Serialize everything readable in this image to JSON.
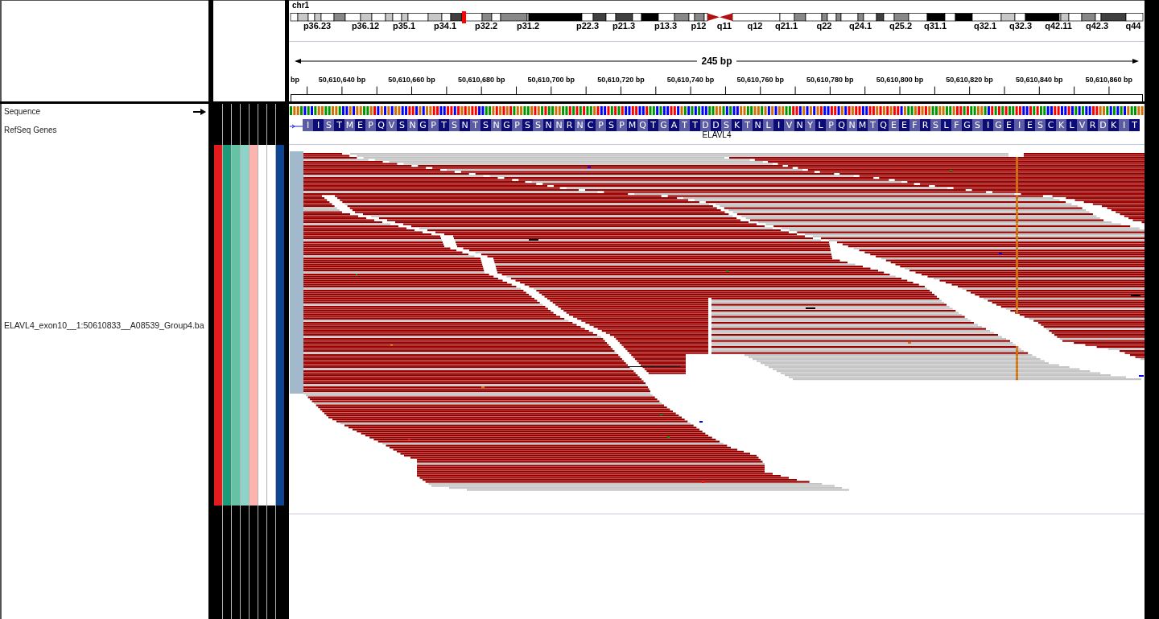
{
  "header": {
    "chromosome": "chr1",
    "cytobands": [
      "p36.23",
      "p36.12",
      "p35.1",
      "p34.1",
      "p32.2",
      "p31.2",
      "p22.3",
      "p21.3",
      "p13.3",
      "p12",
      "q11",
      "q12",
      "q21.1",
      "q22",
      "q24.1",
      "q25.2",
      "q31.1",
      "q32.1",
      "q32.3",
      "q42.11",
      "q42.3",
      "q44"
    ],
    "span": "245 bp",
    "ruler_labels": [
      "bp",
      "50,610,640 bp",
      "50,610,660 bp",
      "50,610,680 bp",
      "50,610,700 bp",
      "50,610,720 bp",
      "50,610,740 bp",
      "50,610,760 bp",
      "50,610,780 bp",
      "50,610,800 bp",
      "50,610,820 bp",
      "50,610,840 bp",
      "50,610,860 bp"
    ]
  },
  "tracks": [
    {
      "kind": "sequence",
      "name": "Sequence",
      "forward_strand": true
    },
    {
      "kind": "gene",
      "name": "RefSeq Genes",
      "gene": "ELAVL4",
      "amino_acids": [
        "I",
        "I",
        "S",
        "T",
        "M",
        "E",
        "P",
        "Q",
        "V",
        "S",
        "N",
        "G",
        "P",
        "T",
        "S",
        "N",
        "T",
        "S",
        "N",
        "G",
        "P",
        "S",
        "S",
        "N",
        "N",
        "R",
        "N",
        "C",
        "P",
        "S",
        "P",
        "M",
        "Q",
        "T",
        "G",
        "A",
        "T",
        "T",
        "D",
        "D",
        "S",
        "K",
        "T",
        "N",
        "L",
        "I",
        "V",
        "N",
        "Y",
        "L",
        "P",
        "Q",
        "N",
        "M",
        "T",
        "Q",
        "E",
        "E",
        "F",
        "R",
        "S",
        "L",
        "F",
        "G",
        "S",
        "I",
        "G",
        "E",
        "I",
        "E",
        "S",
        "C",
        "K",
        "L",
        "V",
        "R",
        "D",
        "K",
        "I",
        "T"
      ]
    },
    {
      "kind": "alignment",
      "name": "ELAVL4_exon10__1:50610833__A08539_Group4.ba",
      "attributes": [
        {
          "color": "#e41a1c"
        },
        {
          "color": "#1b9e77"
        },
        {
          "color": "#66c2a5"
        },
        {
          "color": "#8dd3c7"
        },
        {
          "color": "#fbb4ae"
        },
        {
          "color": "#ffffff"
        },
        {
          "color": "#ffffff"
        },
        {
          "color": "#0c4594"
        }
      ]
    }
  ]
}
